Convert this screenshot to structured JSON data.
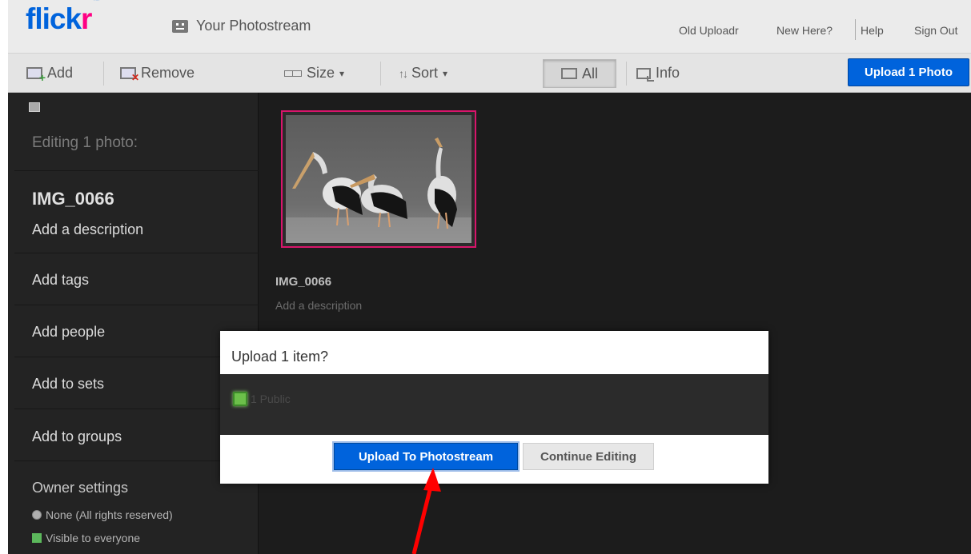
{
  "header": {
    "logo": {
      "main": "flick",
      "accent": "r",
      "mark": "™"
    },
    "stream_label": "Your Photostream",
    "links": {
      "old_uploadr": "Old Uploadr",
      "new_here": "New Here?",
      "help": "Help",
      "sign_out": "Sign Out"
    }
  },
  "toolbar": {
    "add": "Add",
    "remove": "Remove",
    "size": "Size",
    "sort": "Sort",
    "all": "All",
    "info": "Info",
    "upload_button": "Upload 1 Photo",
    "dropdown_caret": "▾"
  },
  "sidebar": {
    "editing_label": "Editing 1 photo:",
    "photo_title": "IMG_0066",
    "description_prompt": "Add a description",
    "items": [
      "Add tags",
      "Add people",
      "Add to sets",
      "Add to groups"
    ],
    "owner_settings": "Owner settings",
    "license": "None (All rights reserved)",
    "privacy": "Visible to everyone"
  },
  "photo": {
    "title": "IMG_0066",
    "description_prompt": "Add a description"
  },
  "dialog": {
    "title": "Upload 1 item?",
    "public_count": "1 Public",
    "confirm_button": "Upload To Photostream",
    "continue_button": "Continue Editing"
  },
  "colors": {
    "flickr_blue": "#0063dc",
    "flickr_pink": "#ff0084",
    "selection_border": "#d8156b",
    "annotation_arrow": "#ff0000",
    "public_green": "#6cc04a"
  }
}
